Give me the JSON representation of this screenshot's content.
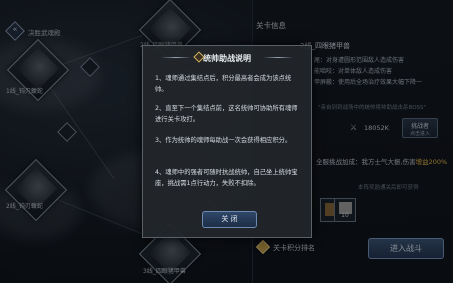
{
  "region": {
    "icon": "diamond-arrow-icon",
    "title": "决胜武魂殿"
  },
  "map_nodes": [
    {
      "label": "1线_钝刃蝮蛇"
    },
    {
      "label": "2线_四眼猪甲兽"
    },
    {
      "label": "2线_钝刃蝮蛇"
    },
    {
      "label": "3线_四眼猪甲兽"
    }
  ],
  "panel": {
    "title": "关卡信息",
    "boss_name": "2线_四眼猪甲兽",
    "skills": [
      "尾：对身遭圆形范围敌人造成伤害",
      "能啮咬：对单体敌人造成伤害",
      "甲屏蔽：使用后全场治疗效果大幅下降一"
    ],
    "quote": "\"亲自到到战场中的统帅将帅助战击杀BOSS\"",
    "power_value": "18052K",
    "fight_button": {
      "line1": "挑战者",
      "line2": "点击进入"
    },
    "buff_text": "全服挑战加成：我方士气大振,伤害",
    "buff_value": "增益200%",
    "hint": "本阵奖励通关后即可获得",
    "rewards": [
      {
        "count": ""
      },
      {
        "count": "10"
      }
    ],
    "rank_label": "关卡积分排名",
    "enter_button": "进入战斗"
  },
  "modal": {
    "title": "统帅助战说明",
    "rules": [
      "1、魂师通过集结点后，积分最高者会成为该点统帅。",
      "2、直至下一个集结点前，这名统帅可协助所有魂师进行关卡攻打。",
      "3、作为统帅的魂师每助战一次会获得相应积分。",
      "4、魂师中的强者可随时抗战统帅，自己坐上统帅宝座，挑战需1点行动力，失败不扣除。"
    ],
    "close_label": "关 闭"
  }
}
